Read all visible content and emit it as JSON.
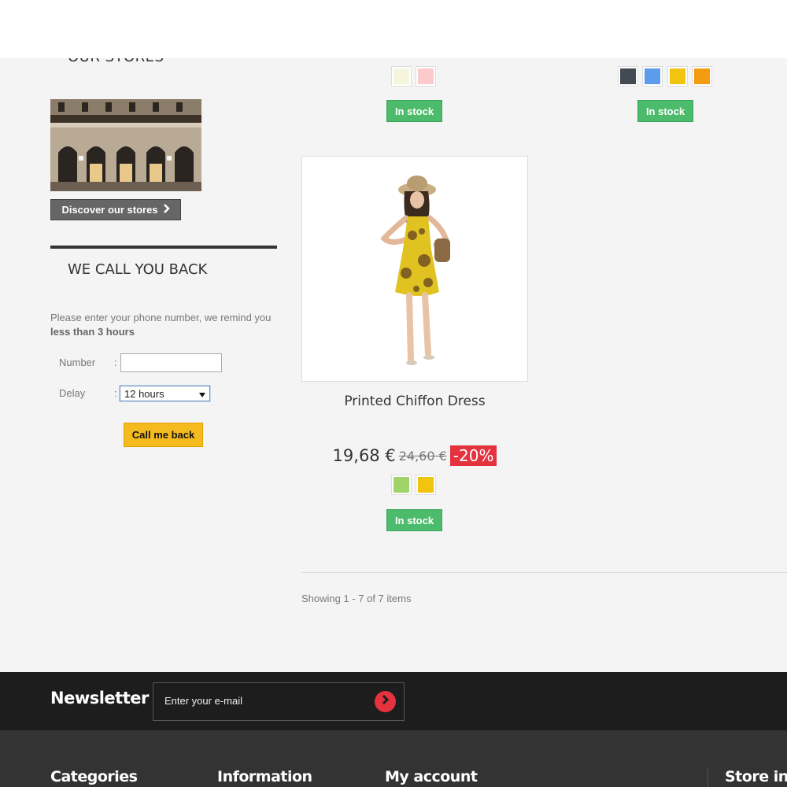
{
  "sidebar": {
    "stores_title": "OUR STORES",
    "discover_label": "Discover our stores",
    "callback_title": "WE CALL YOU BACK",
    "callback_desc_prefix": "Please enter your phone number, we remind you ",
    "callback_desc_bold": "less than 3 hours",
    "number_label": "Number",
    "number_value": "",
    "delay_label": "Delay",
    "delay_value": "12 hours",
    "colon": ":",
    "call_button": "Call me back"
  },
  "products": {
    "top_left": {
      "swatches": [
        "#f5f5dc",
        "#fccacd"
      ],
      "stock": "In stock"
    },
    "top_right": {
      "swatches": [
        "#434a54",
        "#5d9cec",
        "#f1c40f",
        "#f39c11"
      ],
      "stock": "In stock"
    },
    "featured": {
      "name": "Printed Chiffon Dress",
      "price": "19,68 €",
      "old_price": "24,60 €",
      "discount": "-20%",
      "swatches": [
        "#a0d468",
        "#f1c40f"
      ],
      "stock": "In stock"
    }
  },
  "listing": {
    "showing": "Showing 1 - 7 of 7 items"
  },
  "newsletter": {
    "title": "Newsletter",
    "placeholder": "Enter your e-mail"
  },
  "footer": {
    "categories": "Categories",
    "information": "Information",
    "my_account": "My account",
    "store_info": "Store info"
  },
  "colors": {
    "stock_green": "#4cbb6c",
    "discount_red": "#e5323f",
    "callback_yellow": "#f5bb1e"
  }
}
